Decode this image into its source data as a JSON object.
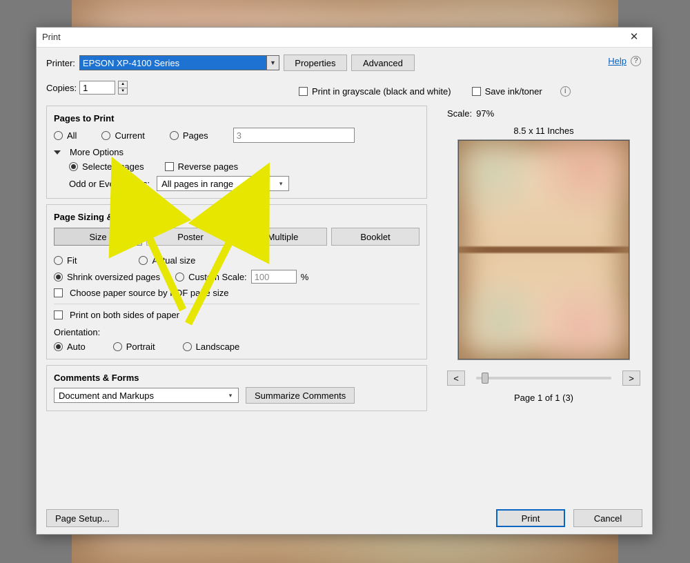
{
  "title": "Print",
  "printerLabel": "Printer:",
  "printer": "EPSON XP-4100 Series",
  "propertiesBtn": "Properties",
  "advancedBtn": "Advanced",
  "helpLink": "Help",
  "copiesLabel": "Copies:",
  "copiesValue": "1",
  "grayscale": "Print in grayscale (black and white)",
  "saveInk": "Save ink/toner",
  "pagesToPrint": {
    "heading": "Pages to Print",
    "all": "All",
    "current": "Current",
    "pages": "Pages",
    "pagesValue": "3",
    "moreOptions": "More Options",
    "selectedPages": "Selected pages",
    "reversePages": "Reverse pages",
    "oddEvenLabel": "Odd or Even Pages:",
    "oddEvenValue": "All pages in range"
  },
  "sizing": {
    "heading": "Page Sizing & Handling",
    "size": "Size",
    "poster": "Poster",
    "multiple": "Multiple",
    "booklet": "Booklet",
    "fit": "Fit",
    "actual": "Actual size",
    "shrink": "Shrink oversized pages",
    "custom": "Custom Scale:",
    "customValue": "100",
    "percent": "%",
    "paperSource": "Choose paper source by PDF page size",
    "duplex": "Print on both sides of paper",
    "orientationLabel": "Orientation:",
    "auto": "Auto",
    "portrait": "Portrait",
    "landscape": "Landscape"
  },
  "comments": {
    "heading": "Comments & Forms",
    "combo": "Document and Markups",
    "summarize": "Summarize Comments"
  },
  "preview": {
    "scaleLabel": "Scale:",
    "scaleValue": "97%",
    "dims": "8.5 x 11 Inches",
    "prev": "<",
    "next": ">",
    "pageOf": "Page 1 of 1 (3)"
  },
  "pageSetup": "Page Setup...",
  "printBtn": "Print",
  "cancelBtn": "Cancel"
}
